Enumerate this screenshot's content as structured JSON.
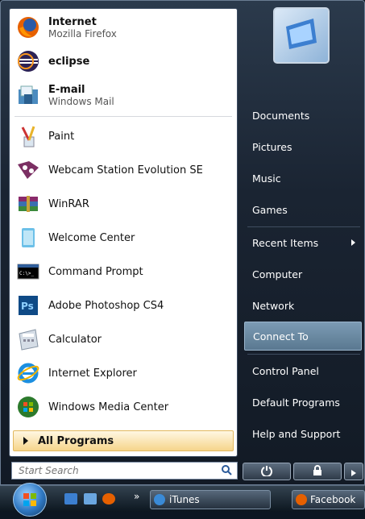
{
  "pinned": [
    {
      "title": "Internet",
      "subtitle": "Mozilla Firefox",
      "icon": "firefox-icon"
    },
    {
      "title": "eclipse",
      "subtitle": "",
      "icon": "eclipse-icon"
    },
    {
      "title": "E-mail",
      "subtitle": "Windows Mail",
      "icon": "mail-icon"
    }
  ],
  "recent": [
    {
      "label": "Paint",
      "icon": "paint-icon"
    },
    {
      "label": "Webcam Station Evolution SE",
      "icon": "webcam-icon"
    },
    {
      "label": "WinRAR",
      "icon": "winrar-icon"
    },
    {
      "label": "Welcome Center",
      "icon": "welcome-center-icon"
    },
    {
      "label": "Command Prompt",
      "icon": "command-prompt-icon"
    },
    {
      "label": "Adobe Photoshop CS4",
      "icon": "photoshop-icon"
    },
    {
      "label": "Calculator",
      "icon": "calculator-icon"
    },
    {
      "label": "Internet Explorer",
      "icon": "internet-explorer-icon"
    },
    {
      "label": "Windows Media Center",
      "icon": "media-center-icon"
    }
  ],
  "all_programs": "All Programs",
  "search_placeholder": "Start Search",
  "right": [
    "Documents",
    "Pictures",
    "Music",
    "Games",
    "Recent Items",
    "Computer",
    "Network",
    "Connect To",
    "Control Panel",
    "Default Programs",
    "Help and Support"
  ],
  "highlighted": "Connect To",
  "taskbar": {
    "itunes": "iTunes",
    "facebook": "Facebook"
  },
  "colors": {
    "highlight": "#6f8fa8",
    "all_programs": "#f6d58b"
  }
}
